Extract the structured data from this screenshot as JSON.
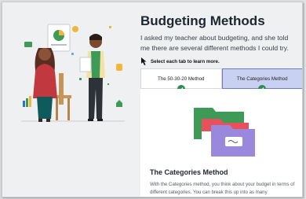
{
  "lesson": {
    "title": "Budgeting Methods",
    "intro": "I asked my teacher about budgeting, and she told me there are several different methods I could try.",
    "hint": "Select each tab to learn more."
  },
  "tabs": [
    {
      "label": "The 50-30-20 Method",
      "completed": true,
      "selected": false
    },
    {
      "label": "The Categories Method",
      "completed": true,
      "selected": true
    }
  ],
  "panel": {
    "heading": "The Categories Method",
    "body": "With the Categories method, you think about your budget in terms of different categories. You can break this up into as many"
  },
  "colors": {
    "selected_tab_bg": "#c9d1f3",
    "selected_tab_border": "#6d7cc7",
    "check": "#2f8a55",
    "folder_green": "#3d9a57",
    "folder_red": "#e8505b",
    "folder_purple": "#9a88dc"
  }
}
